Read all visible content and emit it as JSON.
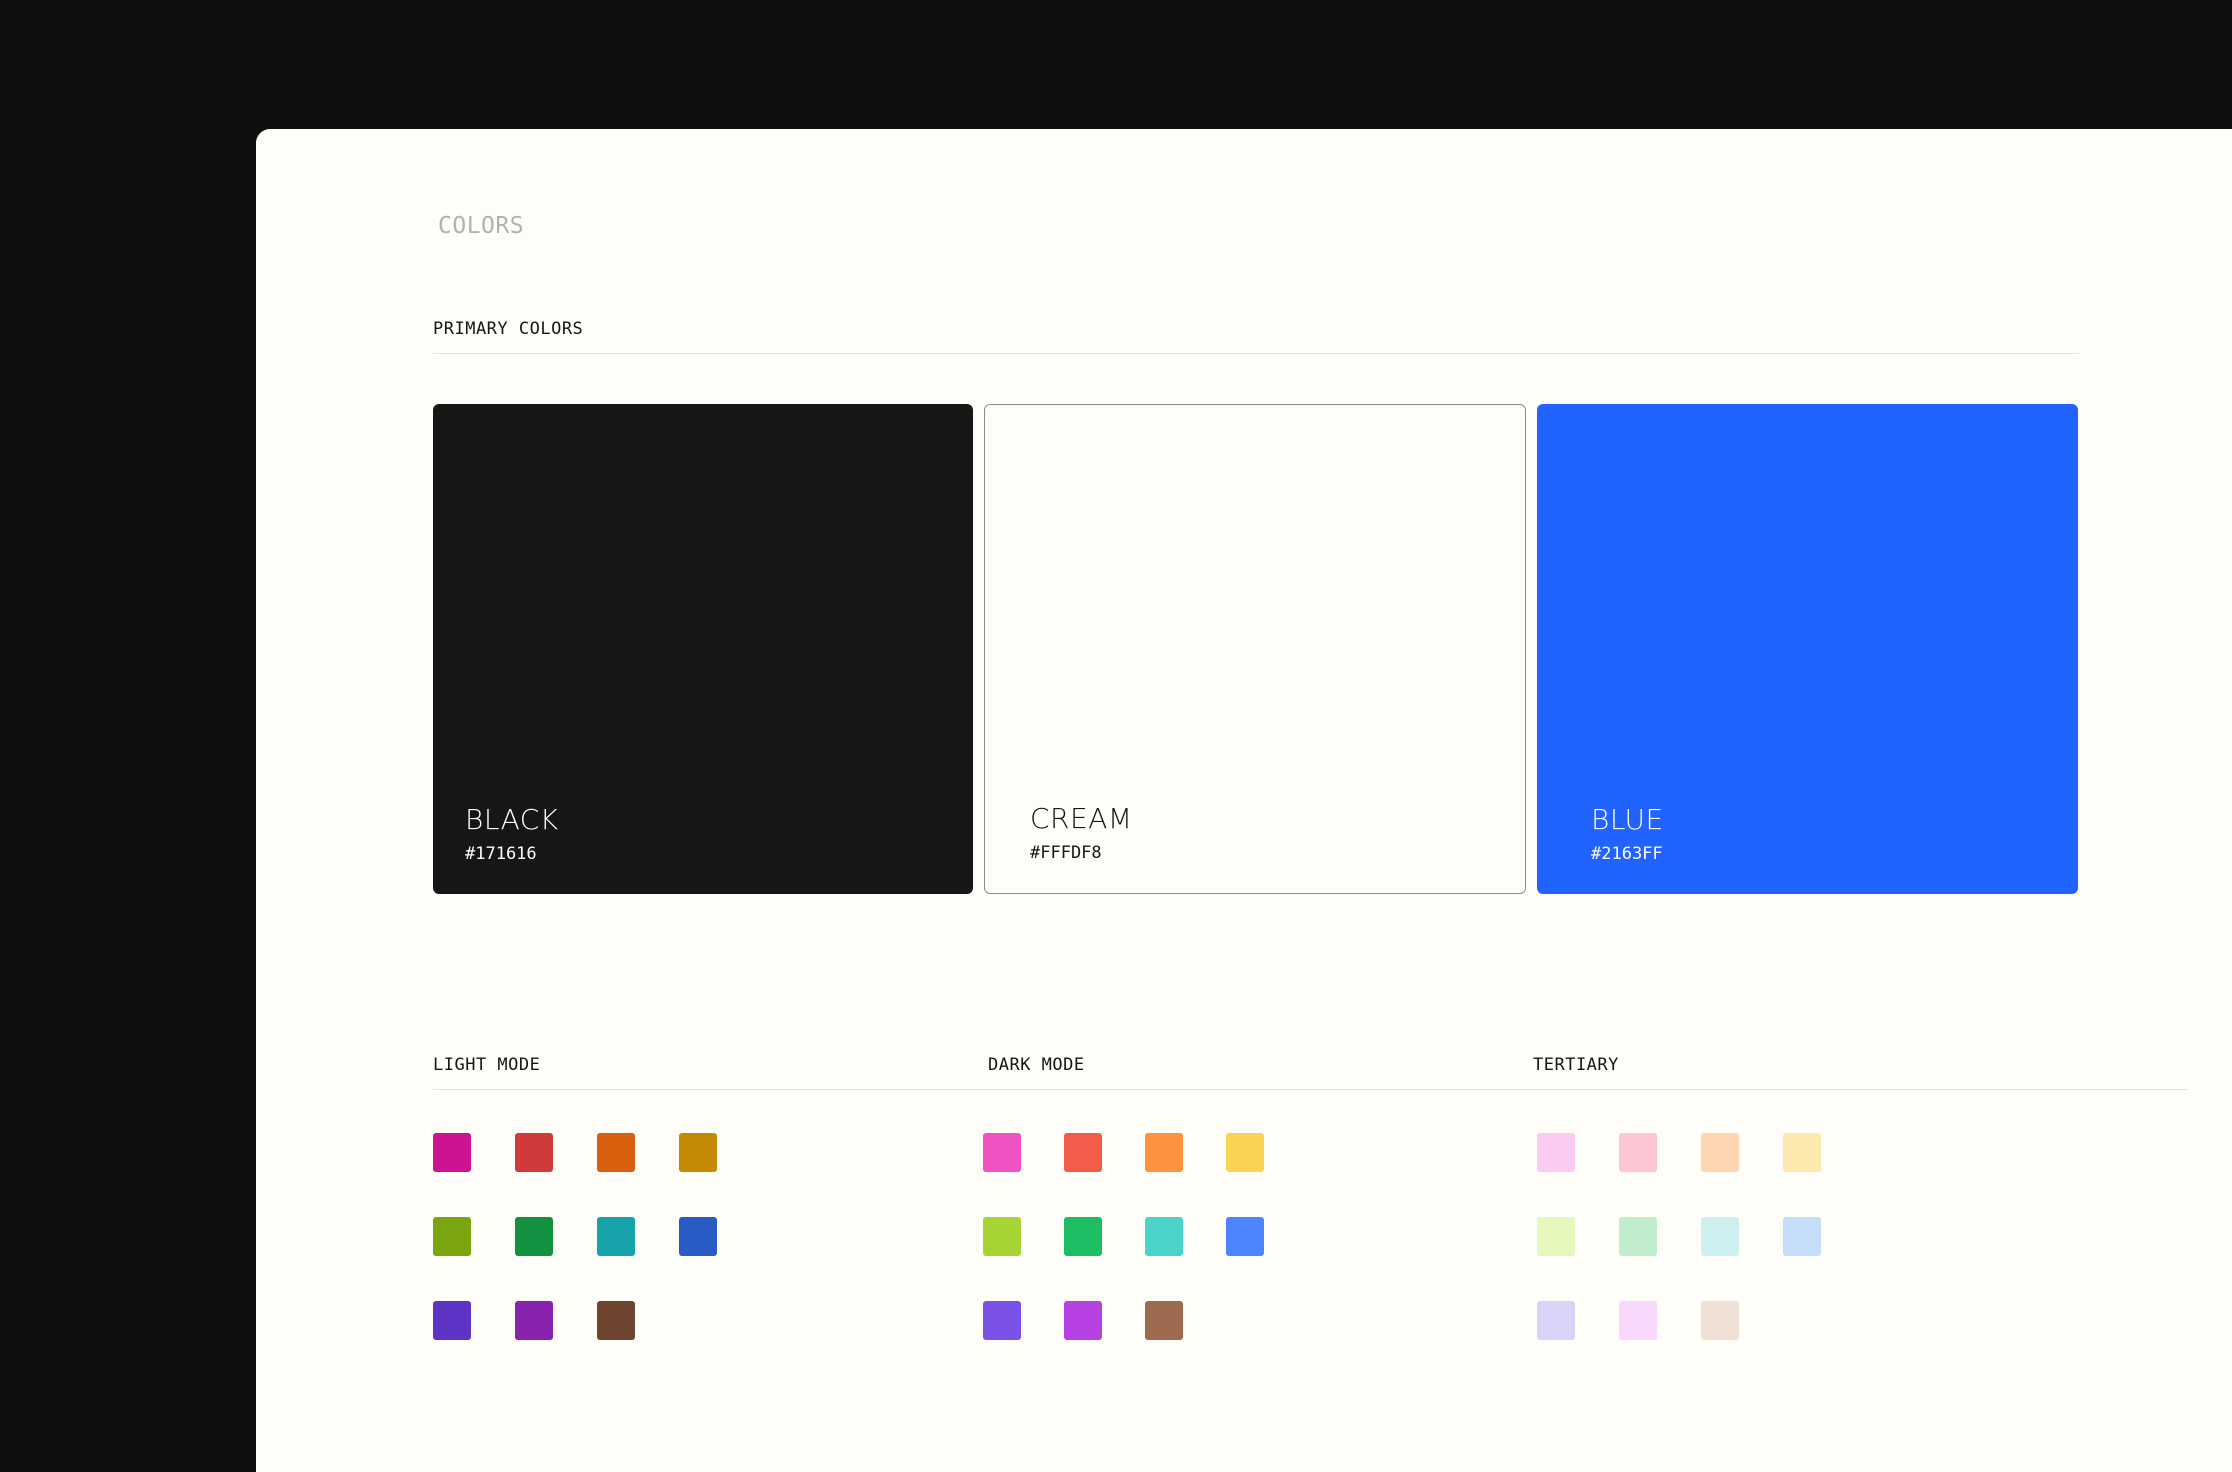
{
  "page_title": "COLORS",
  "primary": {
    "heading": "PRIMARY COLORS",
    "swatches": [
      {
        "name": "BLACK",
        "hex": "#171616",
        "color": "#171616"
      },
      {
        "name": "CREAM",
        "hex": "#FFFDF8",
        "color": "#fffdf8"
      },
      {
        "name": "BLUE",
        "hex": "#2163FF",
        "color": "#2163ff"
      }
    ]
  },
  "palettes": [
    {
      "heading": "LIGHT MODE",
      "colors": [
        "#cc1493",
        "#d03a3a",
        "#d9600f",
        "#c48a06",
        "#7aa50e",
        "#12923e",
        "#16a3aa",
        "#2a5ac4",
        "#5e34c4",
        "#8a22b0",
        "#6e4330"
      ]
    },
    {
      "heading": "DARK MODE",
      "colors": [
        "#f052c2",
        "#f25c48",
        "#fe923f",
        "#f9d452",
        "#a6d434",
        "#1fbd63",
        "#4bd2c9",
        "#4d84ff",
        "#7a52e8",
        "#b841e3",
        "#9e6a50"
      ]
    },
    {
      "heading": "TERTIARY",
      "colors": [
        "#fccbf0",
        "#fcc7d2",
        "#fed5b0",
        "#fde9ad",
        "#e4f8bc",
        "#c0eecc",
        "#cdf0f1",
        "#c5ddf9",
        "#dcd3f9",
        "#f8d9fc",
        "#f0e0d6"
      ]
    }
  ]
}
